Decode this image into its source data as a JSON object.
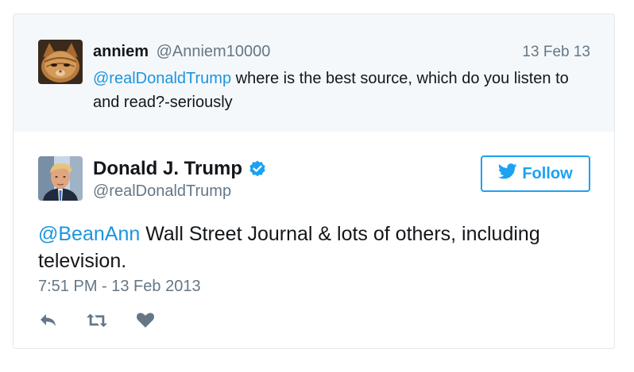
{
  "reply_context": {
    "name": "anniem",
    "handle": "@Anniem10000",
    "date": "13 Feb 13",
    "mention": "@realDonaldTrump",
    "text": " where is the best source, which do you listen to and read?-seriously"
  },
  "tweet": {
    "name": "Donald J. Trump",
    "handle": "@realDonaldTrump",
    "mention": "@BeanAnn",
    "text": " Wall Street Journal & lots of others, including television.",
    "timestamp": "7:51 PM - 13 Feb 2013"
  },
  "follow_button": {
    "label": "Follow",
    "icon": "twitter-bird-icon"
  },
  "actions": [
    {
      "icon": "reply-icon"
    },
    {
      "icon": "retweet-icon"
    },
    {
      "icon": "heart-icon"
    }
  ],
  "colors": {
    "accent": "#1da1f2",
    "mention": "#1b95e0",
    "muted": "#657786",
    "action_icon": "#657786",
    "context_bg": "#f5f8fa"
  }
}
